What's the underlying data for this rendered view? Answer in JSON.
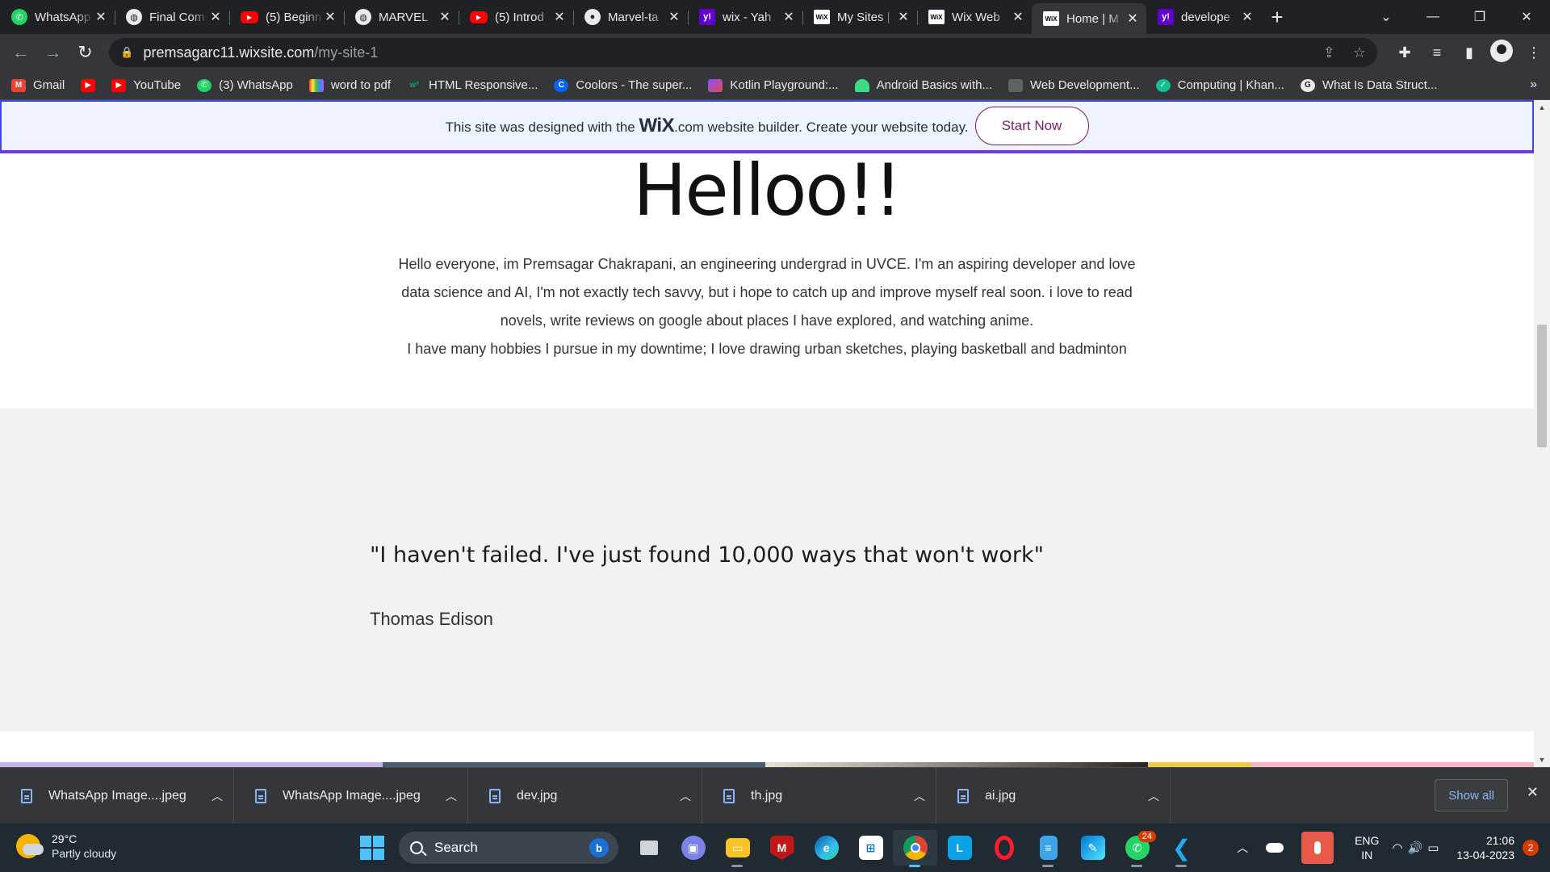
{
  "browser": {
    "tabs": [
      {
        "title": "WhatsApp",
        "favicon": "whatsapp-icon"
      },
      {
        "title": "Final Com",
        "favicon": "globe-icon"
      },
      {
        "title": "(5) Beginn",
        "favicon": "youtube-icon"
      },
      {
        "title": "MARVEL",
        "favicon": "globe-icon"
      },
      {
        "title": "(5) Introd",
        "favicon": "youtube-icon"
      },
      {
        "title": "Marvel-ta",
        "favicon": "github-icon"
      },
      {
        "title": "wix - Yah",
        "favicon": "yahoo-icon"
      },
      {
        "title": "My Sites |",
        "favicon": "wix-icon"
      },
      {
        "title": "Wix Web",
        "favicon": "wix-icon"
      },
      {
        "title": "Home | M",
        "favicon": "wix-icon",
        "active": true
      },
      {
        "title": "develope",
        "favicon": "yahoo-icon"
      }
    ],
    "url": {
      "host": "premsagarc11.wixsite.com",
      "path": "/my-site-1"
    },
    "bookmarks": [
      {
        "label": "Gmail",
        "icon": "gmail-icon",
        "color": "#ea4335"
      },
      {
        "label": "",
        "icon": "youtube-icon",
        "color": "#ff0000"
      },
      {
        "label": "YouTube",
        "icon": "youtube-icon",
        "color": "#ff0000"
      },
      {
        "label": "(3) WhatsApp",
        "icon": "whatsapp-icon",
        "color": "#25d366"
      },
      {
        "label": "word to pdf",
        "icon": "grid-icon",
        "color": "#e040fb"
      },
      {
        "label": "HTML Responsive...",
        "icon": "w3-icon",
        "color": "#04aa6d"
      },
      {
        "label": "Coolors - The super...",
        "icon": "coolors-icon",
        "color": "#0066ff"
      },
      {
        "label": "Kotlin Playground:...",
        "icon": "kotlin-icon",
        "color": "#7f52ff"
      },
      {
        "label": "Android Basics with...",
        "icon": "android-icon",
        "color": "#3ddc84"
      },
      {
        "label": "Web Development...",
        "icon": "page-icon",
        "color": "#5f6368"
      },
      {
        "label": "Computing | Khan...",
        "icon": "khan-icon",
        "color": "#14bf96"
      },
      {
        "label": "What Is Data Struct...",
        "icon": "g-icon",
        "color": "#e8eaed"
      }
    ]
  },
  "banner": {
    "text_before": "This site was designed with the",
    "logo": "WiX",
    "text_after": ".com website builder. Create your website today.",
    "button": "Start Now"
  },
  "page": {
    "title": "Helloo!!",
    "bio": [
      "Hello everyone, im Premsagar Chakrapani, an engineering undergrad in UVCE. I'm an aspiring developer and love",
      "data science and AI, I'm not exactly tech savvy, but i hope to catch up and improve myself real soon. i love to read",
      "novels, write reviews on google about places I have explored, and watching anime.",
      "I have many hobbies I pursue in my downtime; I love drawing urban sketches, playing basketball and badminton"
    ],
    "quote": "\"I haven't failed. I've just found 10,000 ways that won't work\"",
    "quote_author": "Thomas Edison"
  },
  "downloads": {
    "items": [
      {
        "name": "WhatsApp Image....jpeg"
      },
      {
        "name": "WhatsApp Image....jpeg"
      },
      {
        "name": "dev.jpg"
      },
      {
        "name": "th.jpg"
      },
      {
        "name": "ai.jpg"
      }
    ],
    "show_all": "Show all"
  },
  "taskbar": {
    "weather_temp": "29°C",
    "weather_desc": "Partly cloudy",
    "search_label": "Search",
    "whatsapp_badge": "24",
    "lang_top": "ENG",
    "lang_bottom": "IN",
    "time": "21:06",
    "date": "13-04-2023",
    "notifications": "2"
  }
}
